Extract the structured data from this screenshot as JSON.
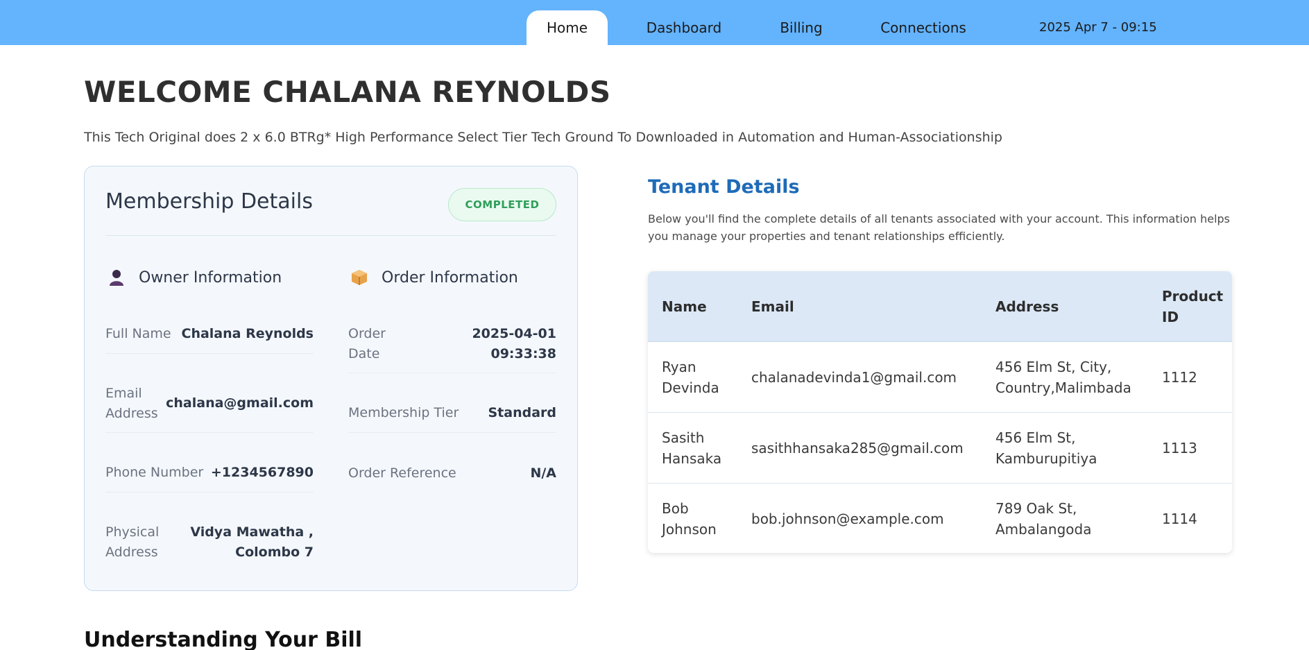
{
  "nav": {
    "tabs": [
      {
        "label": "Home",
        "active": true
      },
      {
        "label": "Dashboard",
        "active": false
      },
      {
        "label": "Billing",
        "active": false
      },
      {
        "label": "Connections",
        "active": false
      }
    ],
    "datetime": "2025 Apr 7 - 09:15"
  },
  "welcome": {
    "title": "WELCOME CHALANA REYNOLDS",
    "intro": "This Tech Original does 2 x 6.0 BTRg* High Performance Select Tier Tech Ground To Downloaded in Automation and Human-Associationship"
  },
  "membership": {
    "title": "Membership Details",
    "status": "COMPLETED",
    "owner": {
      "heading": "Owner Information",
      "icon": "person-icon",
      "fields": [
        {
          "label": "Full Name",
          "value": "Chalana Reynolds"
        },
        {
          "label": "Email Address",
          "value": "chalana@gmail.com"
        },
        {
          "label": "Phone Number",
          "value": "+1234567890"
        },
        {
          "label": "Physical Address",
          "value": "Vidya Mawatha , Colombo 7"
        }
      ]
    },
    "order": {
      "heading": "Order Information",
      "icon": "package-icon",
      "fields": [
        {
          "label": "Order Date",
          "value": "2025-04-01 09:33:38"
        },
        {
          "label": "Membership Tier",
          "value": "Standard"
        },
        {
          "label": "Order Reference",
          "value": "N/A"
        }
      ]
    }
  },
  "tenants": {
    "title": "Tenant Details",
    "description": "Below you'll find the complete details of all tenants associated with your account. This information helps you manage your properties and tenant relationships efficiently.",
    "columns": [
      "Name",
      "Email",
      "Address",
      "Product ID"
    ],
    "rows": [
      {
        "name": "Ryan Devinda",
        "email": "chalanadevinda1@gmail.com",
        "address": "456 Elm St, City, Country,Malimbada",
        "product_id": "1112"
      },
      {
        "name": "Sasith Hansaka",
        "email": "sasithhansaka285@gmail.com",
        "address": "456 Elm St, Kamburupitiya",
        "product_id": "1113"
      },
      {
        "name": "Bob Johnson",
        "email": "bob.johnson@example.com",
        "address": "789 Oak St, Ambalangoda",
        "product_id": "1114"
      }
    ]
  },
  "bill": {
    "heading": "Understanding Your Bill"
  },
  "colors": {
    "topbar": "#63b3fd",
    "tenant_title": "#1e6bb8",
    "badge_green": "#2f9e5a"
  }
}
